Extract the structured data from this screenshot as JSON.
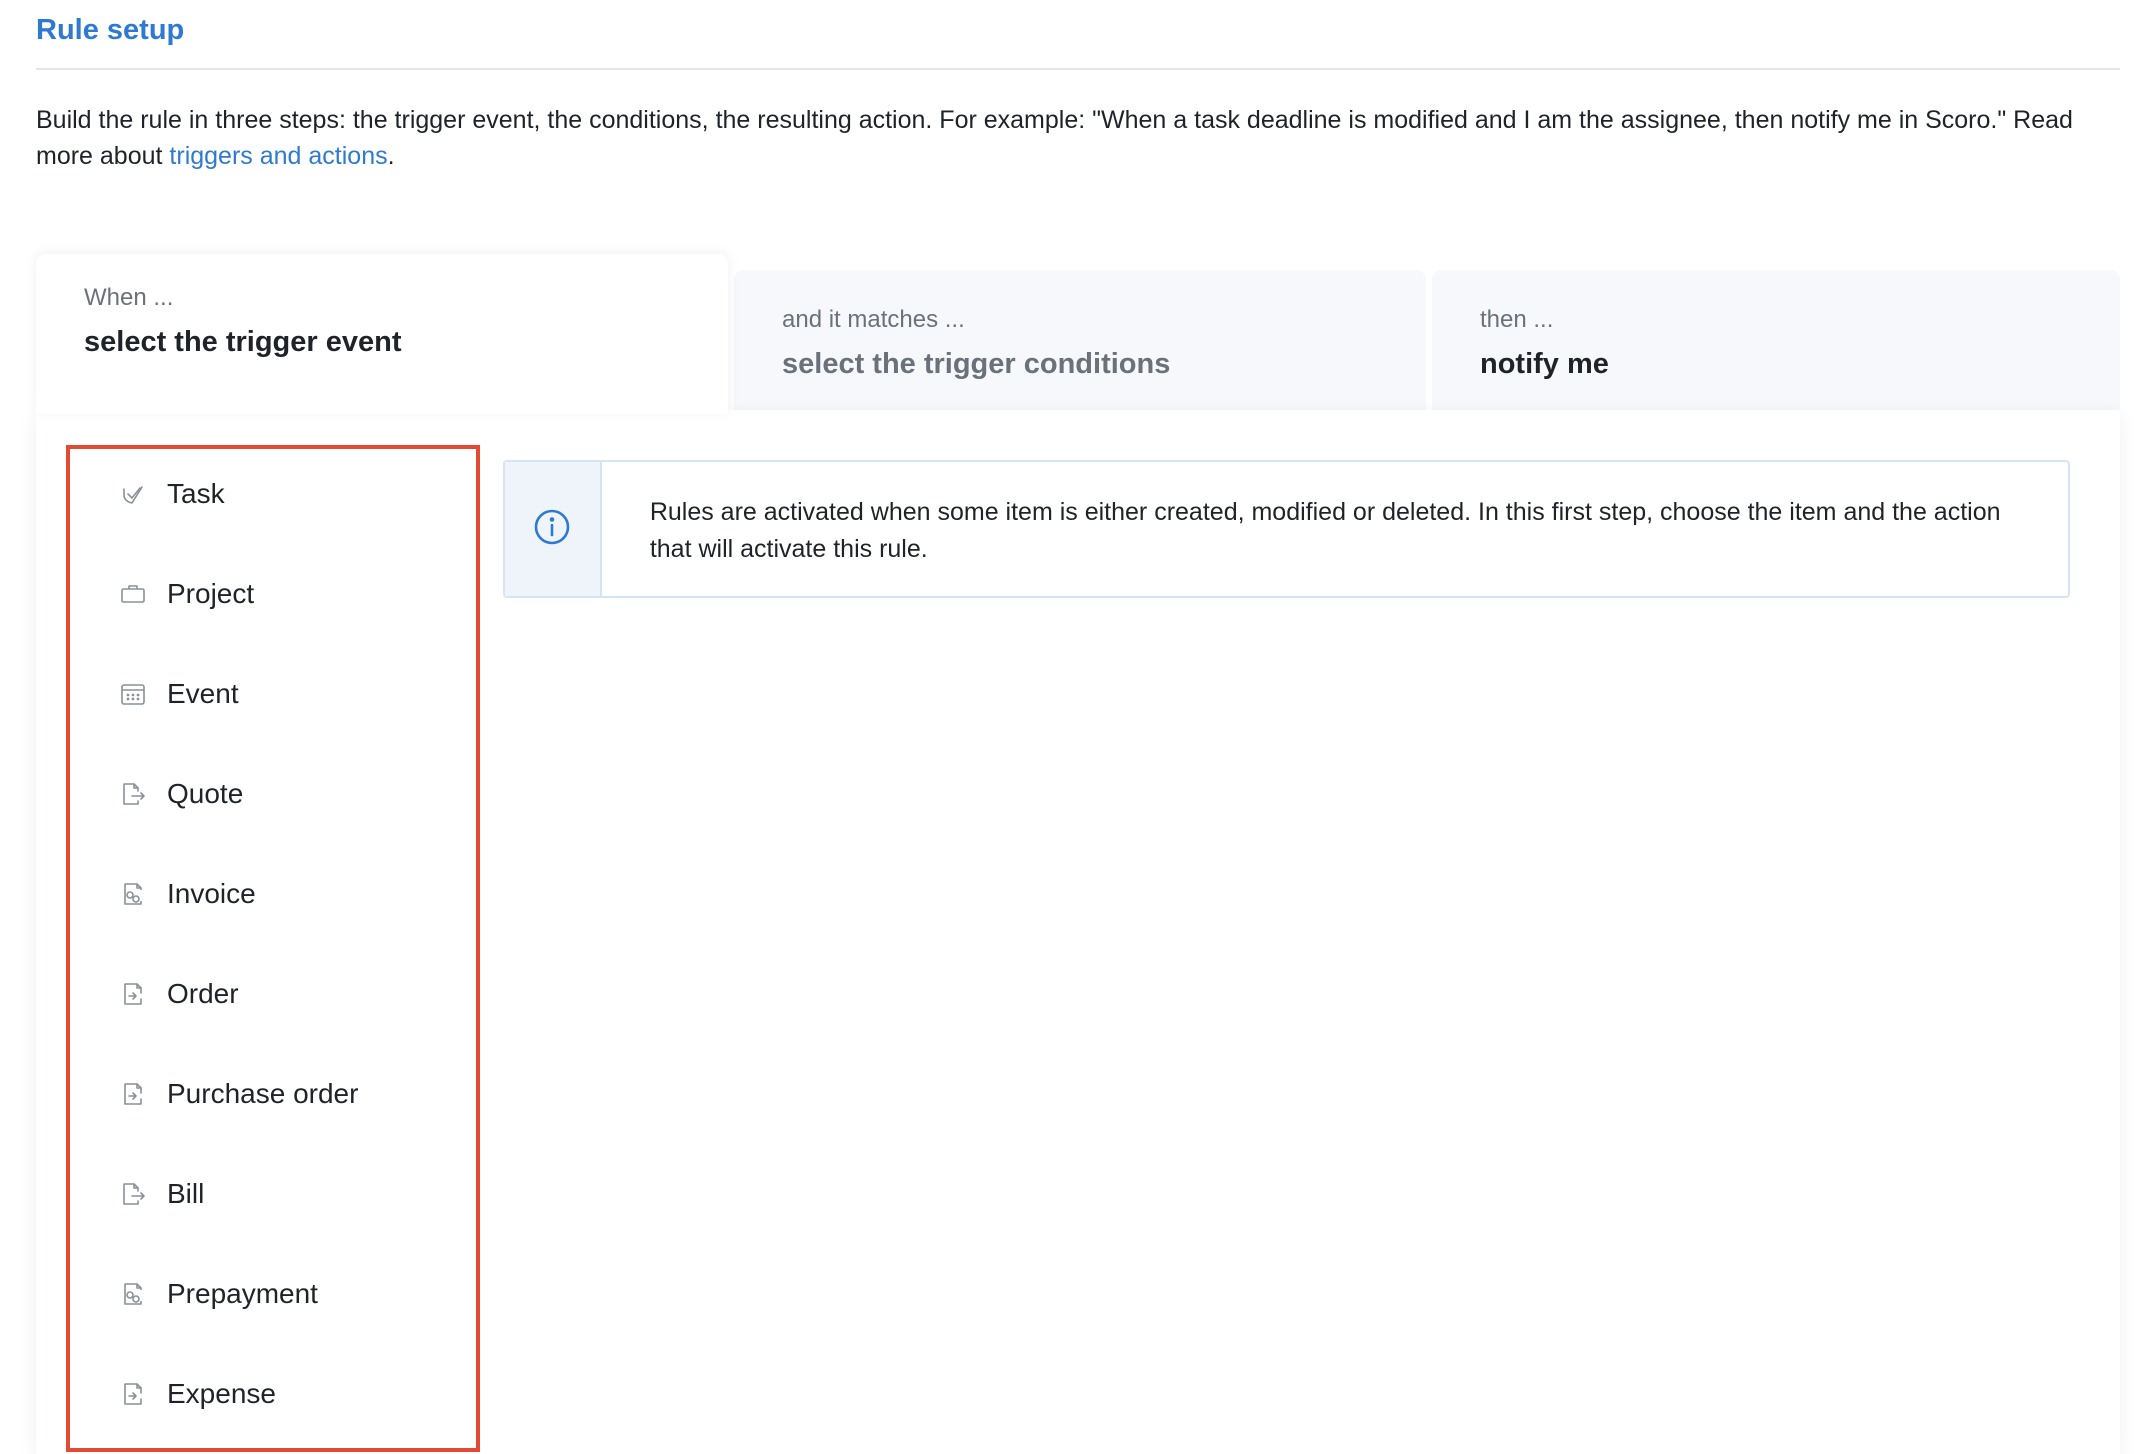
{
  "header": {
    "title": "Rule setup"
  },
  "description": {
    "text_before": "Build the rule in three steps: the trigger event, the conditions, the resulting action. For example: \"When a task deadline is modified and I am the assignee, then notify me in Scoro.\" Read more about ",
    "link_text": "triggers and actions",
    "text_after": "."
  },
  "steps": [
    {
      "caption": "When ...",
      "value": "select the trigger event"
    },
    {
      "caption": "and it matches ...",
      "value": "select the trigger conditions"
    },
    {
      "caption": "then ...",
      "value": "notify me"
    }
  ],
  "items": [
    {
      "label": "Task",
      "icon": "task-check-icon"
    },
    {
      "label": "Project",
      "icon": "briefcase-icon"
    },
    {
      "label": "Event",
      "icon": "calendar-icon"
    },
    {
      "label": "Quote",
      "icon": "document-arrow-icon"
    },
    {
      "label": "Invoice",
      "icon": "document-coins-icon"
    },
    {
      "label": "Order",
      "icon": "document-export-icon"
    },
    {
      "label": "Purchase order",
      "icon": "document-export-icon"
    },
    {
      "label": "Bill",
      "icon": "document-arrow-icon"
    },
    {
      "label": "Prepayment",
      "icon": "document-coins-icon"
    },
    {
      "label": "Expense",
      "icon": "document-export-icon"
    }
  ],
  "info": {
    "icon": "info-icon",
    "text": "Rules are activated when some item is either created, modified or deleted. In this first step, choose the item and the action that will activate this rule."
  },
  "colors": {
    "accent": "#2f7ad1",
    "highlight_border": "#e24a33"
  }
}
